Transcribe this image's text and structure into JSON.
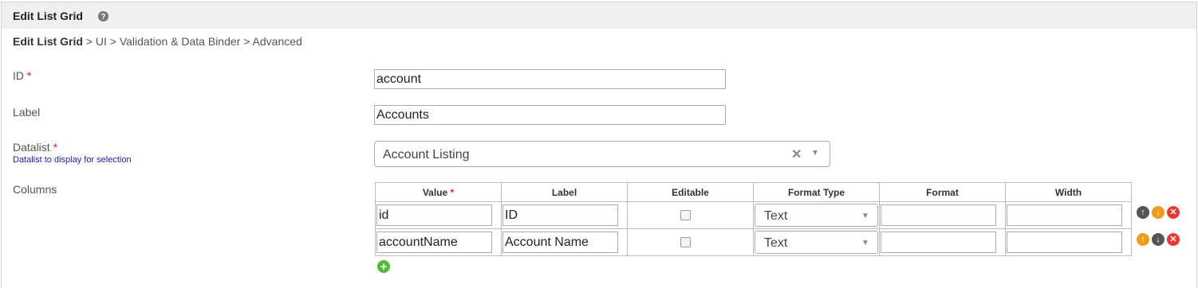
{
  "header": {
    "title": "Edit List Grid",
    "help_icon": "question-circle-icon"
  },
  "breadcrumb": {
    "current": "Edit List Grid",
    "separator": ">",
    "items": [
      "UI",
      "Validation & Data Binder",
      "Advanced"
    ]
  },
  "form": {
    "required_mark": "*",
    "id": {
      "label": "ID",
      "value": "account"
    },
    "label": {
      "label": "Label",
      "value": "Accounts"
    },
    "datalist": {
      "label": "Datalist",
      "hint": "Datalist to display for selection",
      "value": "Account Listing",
      "clear_glyph": "✕",
      "caret_glyph": "▼"
    },
    "columns": {
      "label": "Columns",
      "headers": [
        "Value",
        "Label",
        "Editable",
        "Format Type",
        "Format",
        "Width"
      ],
      "rows": [
        {
          "value": "id",
          "label": "ID",
          "editable": false,
          "format_type": "Text",
          "format": "",
          "width": "",
          "actions": [
            "move-up-icon",
            "move-down-icon",
            "delete-icon"
          ]
        },
        {
          "value": "accountName",
          "label": "Account Name",
          "editable": false,
          "format_type": "Text",
          "format": "",
          "width": "",
          "actions": [
            "move-up-icon",
            "move-down-icon",
            "delete-icon"
          ]
        }
      ],
      "add_icon": "add-row-icon"
    }
  },
  "colors": {
    "title_bar": "#efefef",
    "required": "#e02020",
    "hint": "#1a1acc",
    "orange": "#f09a18",
    "red": "#e8392c",
    "green": "#4fbb2d"
  }
}
